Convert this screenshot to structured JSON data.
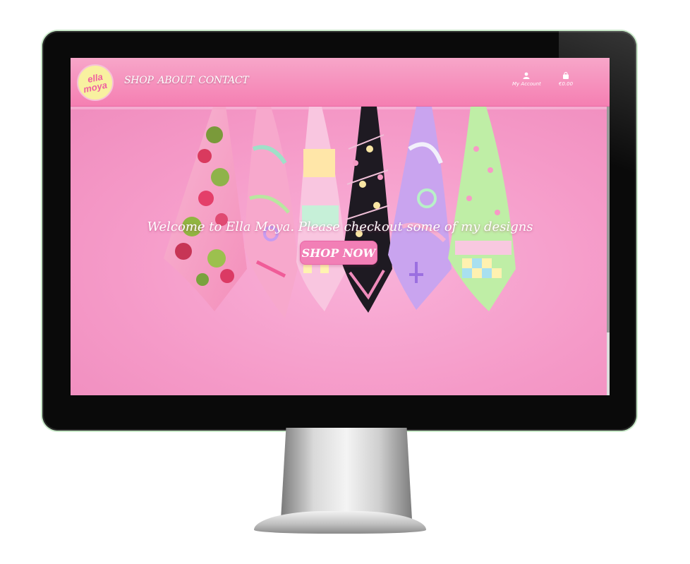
{
  "brand": {
    "logo_line1": "ella",
    "logo_line2": "moya"
  },
  "nav": {
    "items": [
      "SHOP",
      "ABOUT",
      "CONTACT"
    ]
  },
  "account": {
    "label": "My Account",
    "icon": "user-icon"
  },
  "cart": {
    "label": "€0.00",
    "icon": "shopping-bag-icon"
  },
  "hero": {
    "welcome": "Welcome to Ella Moya. Please checkout some of my designs",
    "cta": "SHOP NOW"
  },
  "colors": {
    "header": "#f57fb2",
    "hero_bg": "#f59ac8",
    "button": "#f27fb6",
    "logo_bg": "#f8f1a0"
  }
}
